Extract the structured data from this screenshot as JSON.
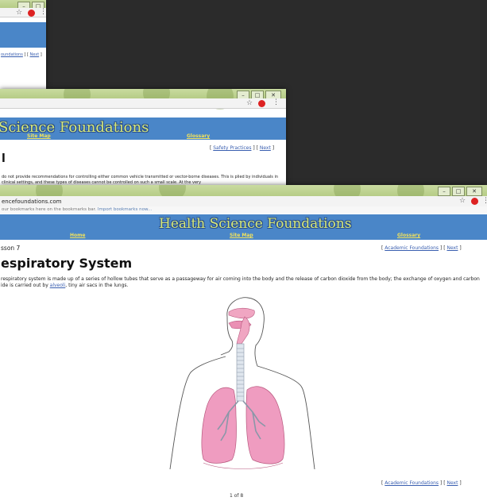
{
  "back_window": {
    "nav_link": "oundations",
    "next": "Next"
  },
  "mid_window": {
    "site_title": "Science Foundations",
    "nav_site_map": "Site Map",
    "nav_glossary": "Glossary",
    "crumb_prev": "Safety Practices",
    "crumb_next": "Next",
    "heading_fragment": "l",
    "para_text": "do not provide recommendations for controlling either common vehicle transmitted or vector-borne diseases. This is plied by individuals in clinical settings, and these types of diseases cannot be controlled on such a small scale. At the very"
  },
  "front_window": {
    "url": "encefoundations.com",
    "bookmarks_text": "our bookmarks here on the bookmarks bar.",
    "bookmarks_link": "Import bookmarks now...",
    "site_title": "Health Science Foundations",
    "nav": {
      "home": "Home",
      "site_map": "Site Map",
      "glossary": "Glossary"
    },
    "lesson": "sson 7",
    "crumb_prev": "Academic Foundations",
    "crumb_next": "Next",
    "heading": "espiratory System",
    "para_line1": "respiratory system is made up of a series of hollow tubes that serve as a passageway for air coming into the body and the release of carbon dioxide from the body; the exchange of oxygen and carbon",
    "para_line2_pre": "ide is carried out by ",
    "para_link": "alveoli",
    "para_line2_post": ", tiny air sacs in the lungs.",
    "bottom_crumb_prev": "Academic Foundations",
    "bottom_crumb_next": "Next",
    "page_count": "1 of 8"
  },
  "colors": {
    "chrome": "#b6cc86",
    "banner": "#4a86c8",
    "title": "#d7e97a",
    "nav": "#f2e25c",
    "link": "#3a5fb0"
  }
}
